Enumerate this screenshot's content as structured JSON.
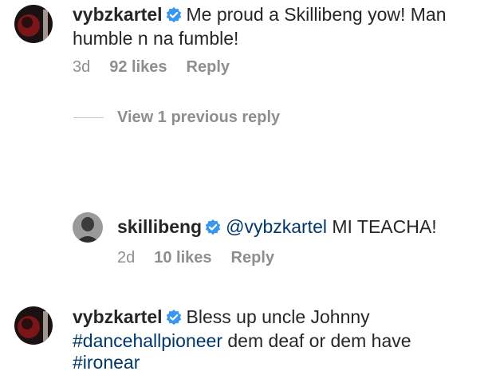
{
  "comments": [
    {
      "username": "vybzkartel",
      "text_line1": "Me proud a Skillibeng yow! Man",
      "text_line2": "humble n na fumble!",
      "time": "3d",
      "likes": "92 likes",
      "reply": "Reply"
    },
    {
      "username": "vybzkartel",
      "text_part1": "Bless up uncle Johnny",
      "hashtag1": "#dancehallpioneer",
      "text_part2": " dem deaf or dem have",
      "hashtag2": "#ironear"
    }
  ],
  "view_replies": {
    "label": "View 1 previous reply"
  },
  "reply": {
    "username": "skillibeng",
    "mention": "@vybzkartel",
    "text": " MI TEACHA!",
    "time": "2d",
    "likes": "10 likes",
    "reply": "Reply"
  },
  "colors": {
    "text": "#262626",
    "secondary": "#8e8e8e",
    "link": "#00376b",
    "verified": "#3897f0"
  }
}
